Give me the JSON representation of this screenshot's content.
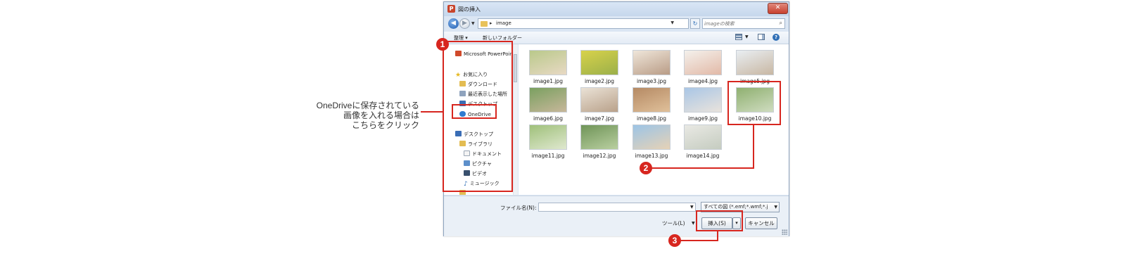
{
  "annotation": {
    "lines": [
      "OneDriveに保存されている",
      "画像を入れる場合は",
      "こちらをクリック"
    ]
  },
  "dialog": {
    "title": "図の挿入",
    "close_label": "✕",
    "address": {
      "path": "image",
      "separator": "▸"
    },
    "search": {
      "placeholder": "imageの検索"
    },
    "toolbar": {
      "organize": "整理 ▾",
      "new_folder": "新しいフォルダー"
    },
    "nav_items": [
      {
        "label": "Microsoft PowerPoint",
        "icon": "powerpoint-icon"
      },
      {
        "label": "お気に入り",
        "icon": "star-icon"
      },
      {
        "label": "ダウンロード",
        "icon": "downloads-icon"
      },
      {
        "label": "最近表示した場所",
        "icon": "recent-places-icon"
      },
      {
        "label": "デスクトップ",
        "icon": "desktop-icon"
      },
      {
        "label": "OneDrive",
        "icon": "cloud-icon"
      },
      {
        "label": "デスクトップ",
        "icon": "desktop-icon"
      },
      {
        "label": "ライブラリ",
        "icon": "library-icon"
      },
      {
        "label": "ドキュメント",
        "icon": "document-icon"
      },
      {
        "label": "ピクチャ",
        "icon": "pictures-icon"
      },
      {
        "label": "ビデオ",
        "icon": "video-icon"
      },
      {
        "label": "ミュージック",
        "icon": "music-icon"
      },
      {
        "label": "",
        "icon": "folder-icon"
      }
    ],
    "files": [
      {
        "name": "image1.jpg",
        "tone": [
          "#b9c98a",
          "#e8d9c4"
        ]
      },
      {
        "name": "image2.jpg",
        "tone": [
          "#d8d24a",
          "#9bb04a"
        ]
      },
      {
        "name": "image3.jpg",
        "tone": [
          "#efe6da",
          "#b99c86"
        ]
      },
      {
        "name": "image4.jpg",
        "tone": [
          "#f4f1ec",
          "#e2b9a7"
        ]
      },
      {
        "name": "image5.jpg",
        "tone": [
          "#e9eef2",
          "#c8b7a3"
        ]
      },
      {
        "name": "image6.jpg",
        "tone": [
          "#7aa060",
          "#c7b79a"
        ]
      },
      {
        "name": "image7.jpg",
        "tone": [
          "#eae2d6",
          "#b9a18a"
        ]
      },
      {
        "name": "image8.jpg",
        "tone": [
          "#b58a64",
          "#e0c09a"
        ]
      },
      {
        "name": "image9.jpg",
        "tone": [
          "#a9c6e6",
          "#e9e3dc"
        ]
      },
      {
        "name": "image10.jpg",
        "tone": [
          "#8fb070",
          "#cfdcc0"
        ]
      },
      {
        "name": "image11.jpg",
        "tone": [
          "#9fc07a",
          "#dfe8cf"
        ]
      },
      {
        "name": "image12.jpg",
        "tone": [
          "#6f9458",
          "#b9cfa0"
        ]
      },
      {
        "name": "image13.jpg",
        "tone": [
          "#9cc4e6",
          "#e6d2b6"
        ]
      },
      {
        "name": "image14.jpg",
        "tone": [
          "#e9e9e4",
          "#c5ccc0"
        ]
      }
    ],
    "filename_label": "ファイル名(N):",
    "filename_value": "",
    "filetype": "すべての図 (*.emf;*.wmf;*.j",
    "tools_label": "ツール(L)",
    "insert_label": "挿入(S)",
    "insert_split": "▾",
    "cancel_label": "キャンセル"
  },
  "badges": [
    "1",
    "2",
    "3"
  ],
  "accent_color": "#d7261f"
}
